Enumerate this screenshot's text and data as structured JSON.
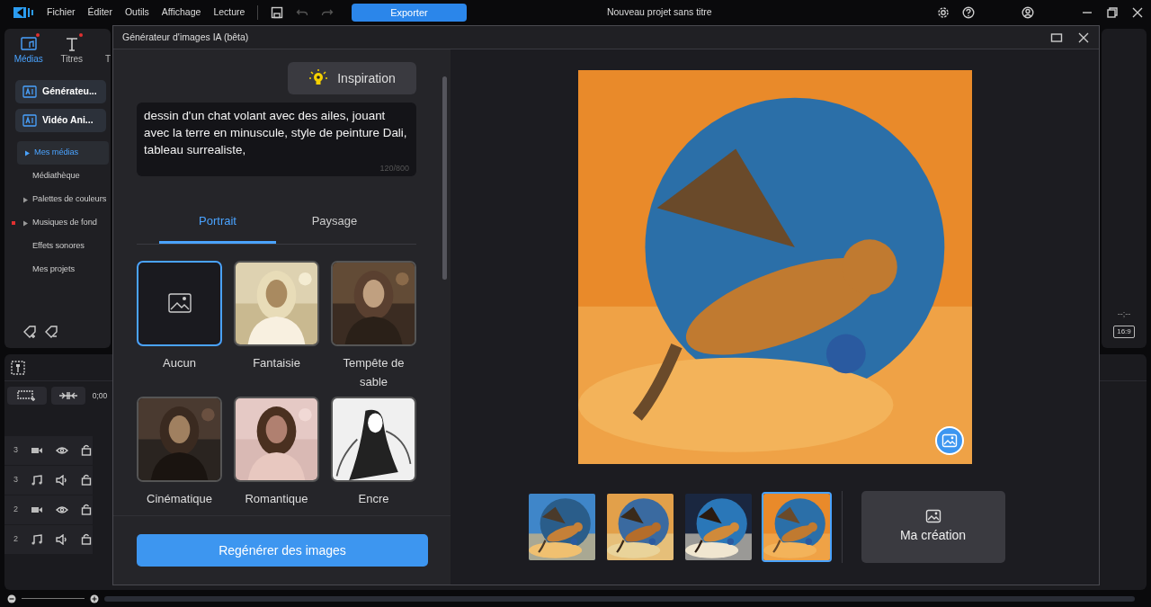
{
  "app": {
    "menu": [
      "Fichier",
      "Éditer",
      "Outils",
      "Affichage",
      "Lecture"
    ],
    "export_button": "Exporter",
    "project_title": "Nouveau projet sans titre"
  },
  "left_tabs": [
    {
      "label": "Médias",
      "kind": "media",
      "selected": true,
      "notified": true
    },
    {
      "label": "Titres",
      "kind": "title",
      "selected": false,
      "notified": true
    },
    {
      "label": "T",
      "kind": "none",
      "selected": false,
      "notified": false
    }
  ],
  "tool_buttons": [
    {
      "label": "Générateu..."
    },
    {
      "label": "Vidéo Ani..."
    }
  ],
  "media_tree": [
    {
      "label": "Mes médias",
      "selected": true,
      "expandable": true,
      "notified": false
    },
    {
      "label": "Médiathèque",
      "selected": false,
      "expandable": false,
      "notified": false
    },
    {
      "label": "Palettes de couleurs",
      "selected": false,
      "expandable": true,
      "notified": false
    },
    {
      "label": "Musiques de fond",
      "selected": false,
      "expandable": true,
      "notified": true
    },
    {
      "label": "Effets sonores",
      "selected": false,
      "expandable": false,
      "notified": false
    },
    {
      "label": "Mes projets",
      "selected": false,
      "expandable": false,
      "notified": false
    }
  ],
  "timeline": {
    "timecode": "0;00",
    "tracks": [
      {
        "number": "3",
        "kind": "video"
      },
      {
        "number": "3",
        "kind": "audio"
      },
      {
        "number": "2",
        "kind": "video"
      },
      {
        "number": "2",
        "kind": "audio"
      }
    ]
  },
  "preview": {
    "timecode": "--;--",
    "aspect": "16:9"
  },
  "dialog": {
    "title": "Générateur d'images IA (bêta)",
    "inspiration_button": "Inspiration",
    "prompt": {
      "value": "dessin d'un chat volant avec des ailes, jouant avec la terre en minuscule, style de peinture Dali, tableau surrealiste,",
      "counter": "120/800"
    },
    "orientation_tabs": [
      {
        "label": "Portrait",
        "selected": true
      },
      {
        "label": "Paysage",
        "selected": false
      }
    ],
    "styles": [
      {
        "label": "Aucun",
        "kind": "none",
        "selected": true
      },
      {
        "label": "Fantaisie",
        "kind": "picture",
        "selected": false
      },
      {
        "label": "Tempête de sable",
        "kind": "picture",
        "selected": false
      },
      {
        "label": "Cinématique",
        "kind": "picture",
        "selected": false
      },
      {
        "label": "Romantique",
        "kind": "picture",
        "selected": false
      },
      {
        "label": "Encre",
        "kind": "picture",
        "selected": false
      }
    ],
    "regenerate_button": "Regénérer des images",
    "results": [
      {
        "selected": false
      },
      {
        "selected": false
      },
      {
        "selected": false
      },
      {
        "selected": true
      }
    ],
    "my_creation_button": "Ma création"
  }
}
